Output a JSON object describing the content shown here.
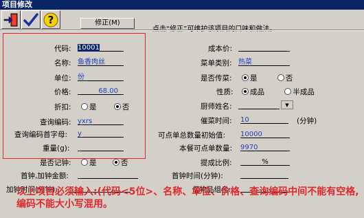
{
  "window": {
    "title": "项目修改"
  },
  "toolbar": {
    "modify_label": "修正(M)",
    "hint": "点击“修正”可维护该项目的口味和做法。"
  },
  "left": {
    "code": {
      "label": "代码:",
      "value": "10001"
    },
    "name": {
      "label": "名称:",
      "value": "鱼香肉丝"
    },
    "unit": {
      "label": "单位:",
      "value": "份"
    },
    "price": {
      "label": "价格:",
      "value": "68.00"
    },
    "discount": {
      "label": "折扣:",
      "opt_yes": "是",
      "opt_no": "否",
      "selected": "否"
    },
    "query_code": {
      "label": "查询编码:",
      "value": "yxrs"
    },
    "query_initial": {
      "label": "查询编码首字母:",
      "value": "y"
    },
    "weight": {
      "label": "重量(g):",
      "value": ""
    },
    "clock": {
      "label": "是否记钟:",
      "opt_yes": "是",
      "opt_no": "否",
      "selected": "否"
    },
    "first_clock": {
      "label": "首钟,加钟金额:",
      "value": ""
    },
    "add_clock_time": {
      "label": "加钟时间(分钟):",
      "value": ""
    }
  },
  "right": {
    "cost_price": {
      "label": "成本价:",
      "value": ""
    },
    "menu_category": {
      "label": "菜单类别:",
      "value": "热菜"
    },
    "transfer": {
      "label": "是否传菜:",
      "opt_yes": "是",
      "opt_no": "否",
      "selected": "是"
    },
    "nature": {
      "label": "性质:",
      "opt_a": "成品",
      "opt_b": "半成品",
      "selected": "成品"
    },
    "chef": {
      "label": "厨师姓名:",
      "value": ""
    },
    "urge_time": {
      "label": "催菜时间:",
      "value": "10",
      "unit": "(分钟)"
    },
    "sellable_init": {
      "label": "可点单总数量初始值:",
      "value": "10000"
    },
    "sellable_now": {
      "label": "本餐可点单数量:",
      "value": "9970"
    },
    "commission": {
      "label": "提成比例:",
      "value": "%"
    },
    "first_clock_time": {
      "label": "首钟时间(分钟):",
      "value": ""
    },
    "borrow_combo": {
      "label": "借物品组合:",
      "value": ""
    }
  },
  "note": "以上项目必须输入:(代码<5位>、名称、单位、价格、查询编码中间不能有空格,编码不能大小写混用。"
}
